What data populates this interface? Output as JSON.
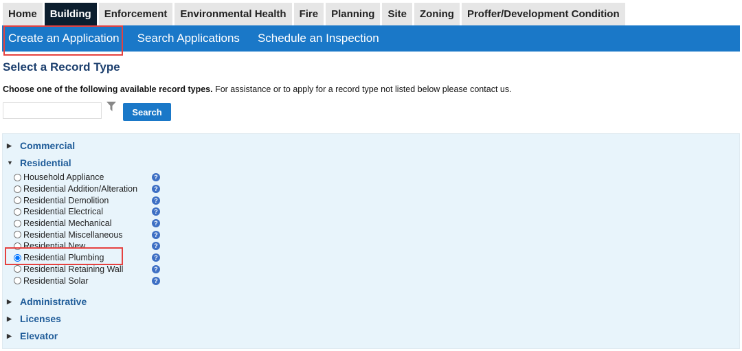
{
  "tabs": [
    "Home",
    "Building",
    "Enforcement",
    "Environmental Health",
    "Fire",
    "Planning",
    "Site",
    "Zoning",
    "Proffer/Development Condition"
  ],
  "active_tab": "Building",
  "subnav": [
    "Create an Application",
    "Search Applications",
    "Schedule an Inspection"
  ],
  "heading": "Select a Record Type",
  "instructions": {
    "bold": "Choose one of the following available record types.",
    "rest": " For assistance or to apply for a record type not listed below please contact us."
  },
  "search": {
    "value": "",
    "placeholder": "",
    "button": "Search"
  },
  "categories": {
    "commercial": "Commercial",
    "residential": "Residential",
    "administrative": "Administrative",
    "licenses": "Licenses",
    "elevator": "Elevator"
  },
  "residential_items": [
    "Household Appliance",
    "Residential Addition/Alteration",
    "Residential Demolition",
    "Residential Electrical",
    "Residential Mechanical",
    "Residential Miscellaneous",
    "Residential New",
    "Residential Plumbing",
    "Residential Retaining Wall",
    "Residential Solar"
  ],
  "selected_item": "Residential Plumbing",
  "colors": {
    "accent": "#1a78c8",
    "active_tab": "#0c1e2e",
    "highlight": "#e5413f",
    "panel": "#e8f4fb"
  }
}
